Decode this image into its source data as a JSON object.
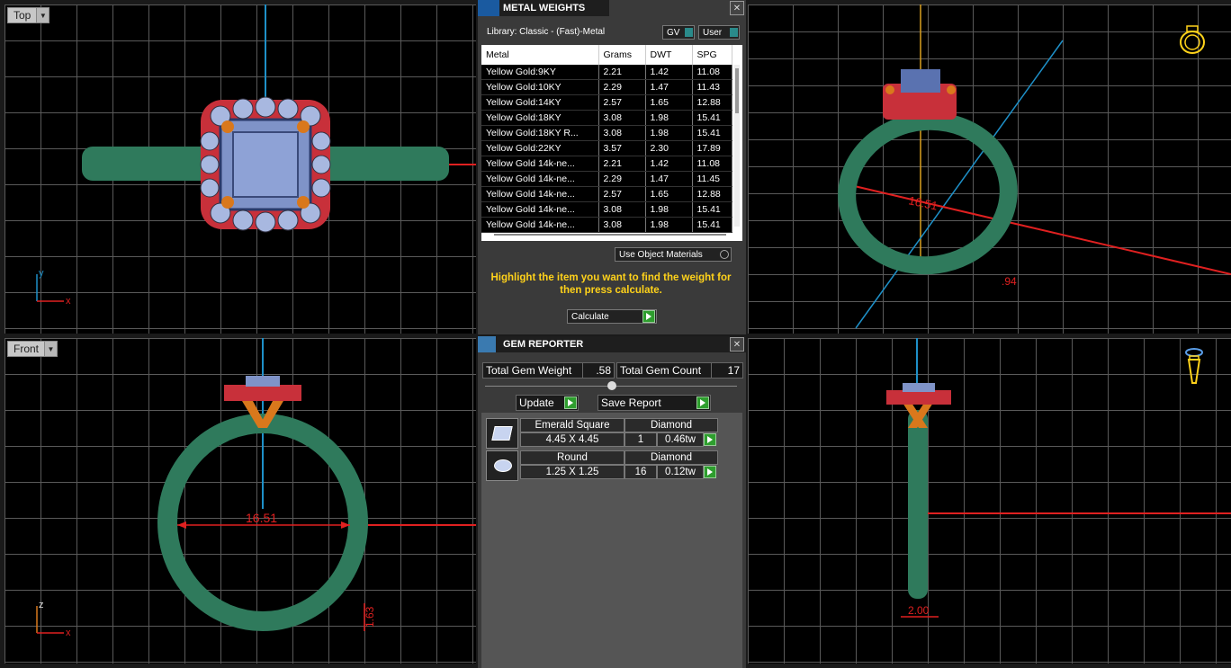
{
  "viewports": {
    "top": {
      "label": "Top",
      "axis_x": "x",
      "axis_y": "y"
    },
    "front": {
      "label": "Front",
      "axis_x": "x",
      "axis_y": "z",
      "dimension": "16.51",
      "dimension_small": "1.63"
    },
    "perspective": {
      "dimension": "16.51",
      "dimension_small": ".94"
    },
    "right": {
      "dimension": "2.00"
    }
  },
  "metal_weights": {
    "title": "METAL WEIGHTS",
    "library": "Library: Classic - (Fast)-Metal",
    "gv_label": "GV",
    "user_label": "User",
    "columns": [
      "Metal",
      "Grams",
      "DWT",
      "SPG"
    ],
    "rows": [
      [
        "Yellow Gold:9KY",
        "2.21",
        "1.42",
        "11.08"
      ],
      [
        "Yellow Gold:10KY",
        "2.29",
        "1.47",
        "11.43"
      ],
      [
        "Yellow Gold:14KY",
        "2.57",
        "1.65",
        "12.88"
      ],
      [
        "Yellow Gold:18KY",
        "3.08",
        "1.98",
        "15.41"
      ],
      [
        "Yellow Gold:18KY R...",
        "3.08",
        "1.98",
        "15.41"
      ],
      [
        "Yellow Gold:22KY",
        "3.57",
        "2.30",
        "17.89"
      ],
      [
        "Yellow Gold 14k-ne...",
        "2.21",
        "1.42",
        "11.08"
      ],
      [
        "Yellow Gold 14k-ne...",
        "2.29",
        "1.47",
        "11.45"
      ],
      [
        "Yellow Gold 14k-ne...",
        "2.57",
        "1.65",
        "12.88"
      ],
      [
        "Yellow Gold 14k-ne...",
        "3.08",
        "1.98",
        "15.41"
      ],
      [
        "Yellow Gold 14k-ne...",
        "3.08",
        "1.98",
        "15.41"
      ]
    ],
    "use_object_materials": "Use Object Materials",
    "instruction": "Highlight the item you want to find the weight for then press calculate.",
    "calculate_label": "Calculate"
  },
  "gem_reporter": {
    "title": "GEM REPORTER",
    "total_weight_label": "Total Gem Weight",
    "total_weight": ".58",
    "total_count_label": "Total Gem Count",
    "total_count": "17",
    "update_label": "Update",
    "save_report_label": "Save Report",
    "gems": [
      {
        "shape": "Emerald Square",
        "size": "4.45 X 4.45",
        "material": "Diamond",
        "count": "1",
        "tw": "0.46tw"
      },
      {
        "shape": "Round",
        "size": "1.25 X 1.25",
        "material": "Diamond",
        "count": "16",
        "tw": "0.12tw"
      }
    ]
  },
  "colors": {
    "ring_green": "#2f7a5c",
    "stone_blue": "#7f93c8",
    "prong_orange": "#d9781c",
    "accent_yellow": "#ffd21a",
    "dim_red": "#e02020"
  }
}
